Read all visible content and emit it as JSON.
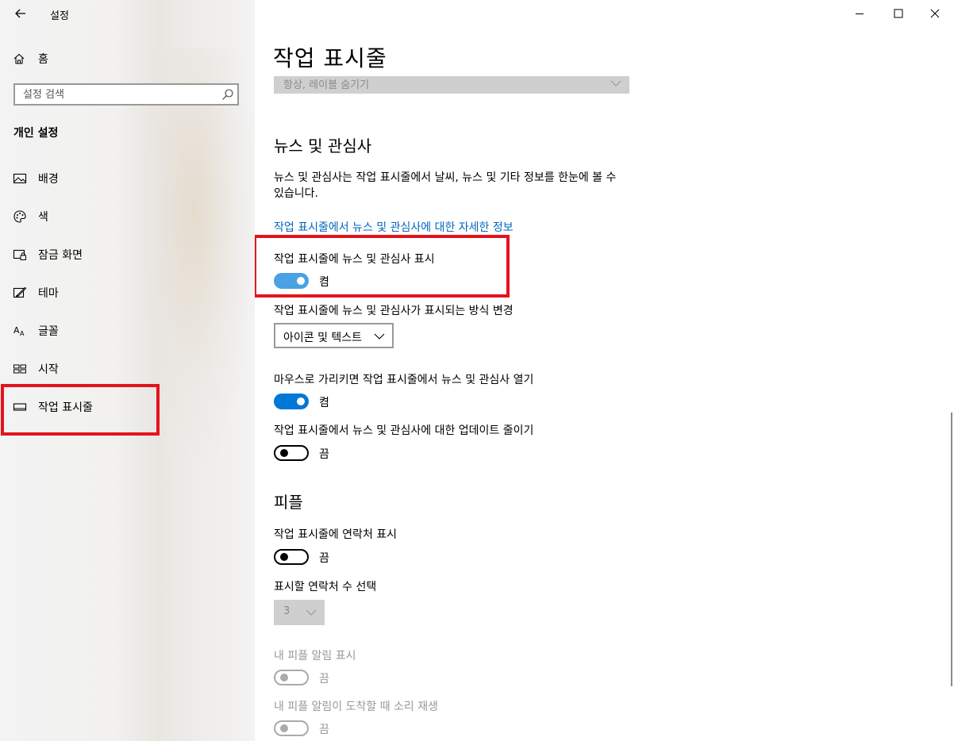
{
  "window": {
    "title": "설정"
  },
  "sidebar": {
    "home_label": "홈",
    "search_placeholder": "설정 검색",
    "section_title": "개인 설정",
    "items": [
      {
        "label": "배경",
        "icon": "image-icon"
      },
      {
        "label": "색",
        "icon": "palette-icon"
      },
      {
        "label": "잠금 화면",
        "icon": "lock-screen-icon"
      },
      {
        "label": "테마",
        "icon": "theme-icon"
      },
      {
        "label": "글꼴",
        "icon": "font-icon"
      },
      {
        "label": "시작",
        "icon": "start-icon"
      },
      {
        "label": "작업 표시줄",
        "icon": "taskbar-icon",
        "selected": true
      }
    ]
  },
  "main": {
    "page_title": "작업 표시줄",
    "prev_dropdown_value": "항상, 레이블 숨기기",
    "news": {
      "heading": "뉴스 및 관심사",
      "description": "뉴스 및 관심사는 작업 표시줄에서 날씨, 뉴스 및 기타 정보를 한눈에 볼 수 있습니다.",
      "link": "작업 표시줄에서 뉴스 및 관심사에 대한 자세한 정보",
      "show_label": "작업 표시줄에 뉴스 및 관심사 표시",
      "show_state": "켬",
      "mode_label": "작업 표시줄에 뉴스 및 관심사가 표시되는 방식 변경",
      "mode_value": "아이콘 및 텍스트",
      "hover_label": "마우스로 가리키면 작업 표시줄에서 뉴스 및 관심사 열기",
      "hover_state": "켬",
      "reduce_label": "작업 표시줄에서 뉴스 및 관심사에 대한 업데이트 줄이기",
      "reduce_state": "끔"
    },
    "people": {
      "heading": "피플",
      "contacts_label": "작업 표시줄에 연락처 표시",
      "contacts_state": "끔",
      "count_label": "표시할 연락처 수 선택",
      "count_value": "3",
      "notify_label": "내 피플 알림 표시",
      "notify_state": "끔",
      "sound_label": "내 피플 알림이 도착할 때 소리 재생",
      "sound_state": "끔"
    }
  },
  "colors": {
    "accent": "#0078d7",
    "link": "#0067c0",
    "highlight_box": "#e3141d"
  }
}
